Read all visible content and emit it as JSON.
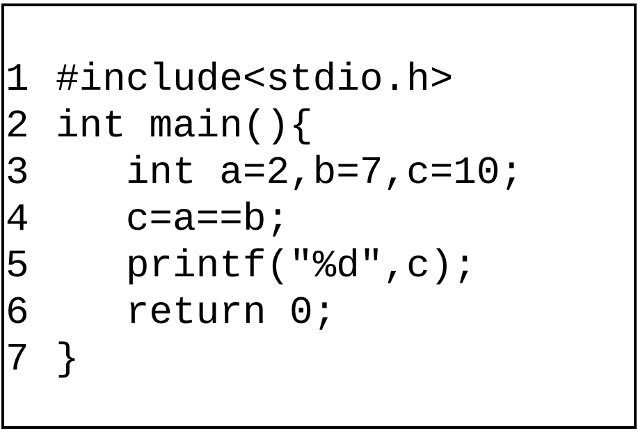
{
  "code_lines": [
    {
      "number": "1",
      "text": "#include<stdio.h>"
    },
    {
      "number": "2",
      "text": "int main(){"
    },
    {
      "number": "3",
      "text": "   int a=2,b=7,c=10;"
    },
    {
      "number": "4",
      "text": "   c=a==b;"
    },
    {
      "number": "5",
      "text": "   printf(\"%d\",c);"
    },
    {
      "number": "6",
      "text": "   return 0;"
    },
    {
      "number": "7",
      "text": "}"
    }
  ]
}
